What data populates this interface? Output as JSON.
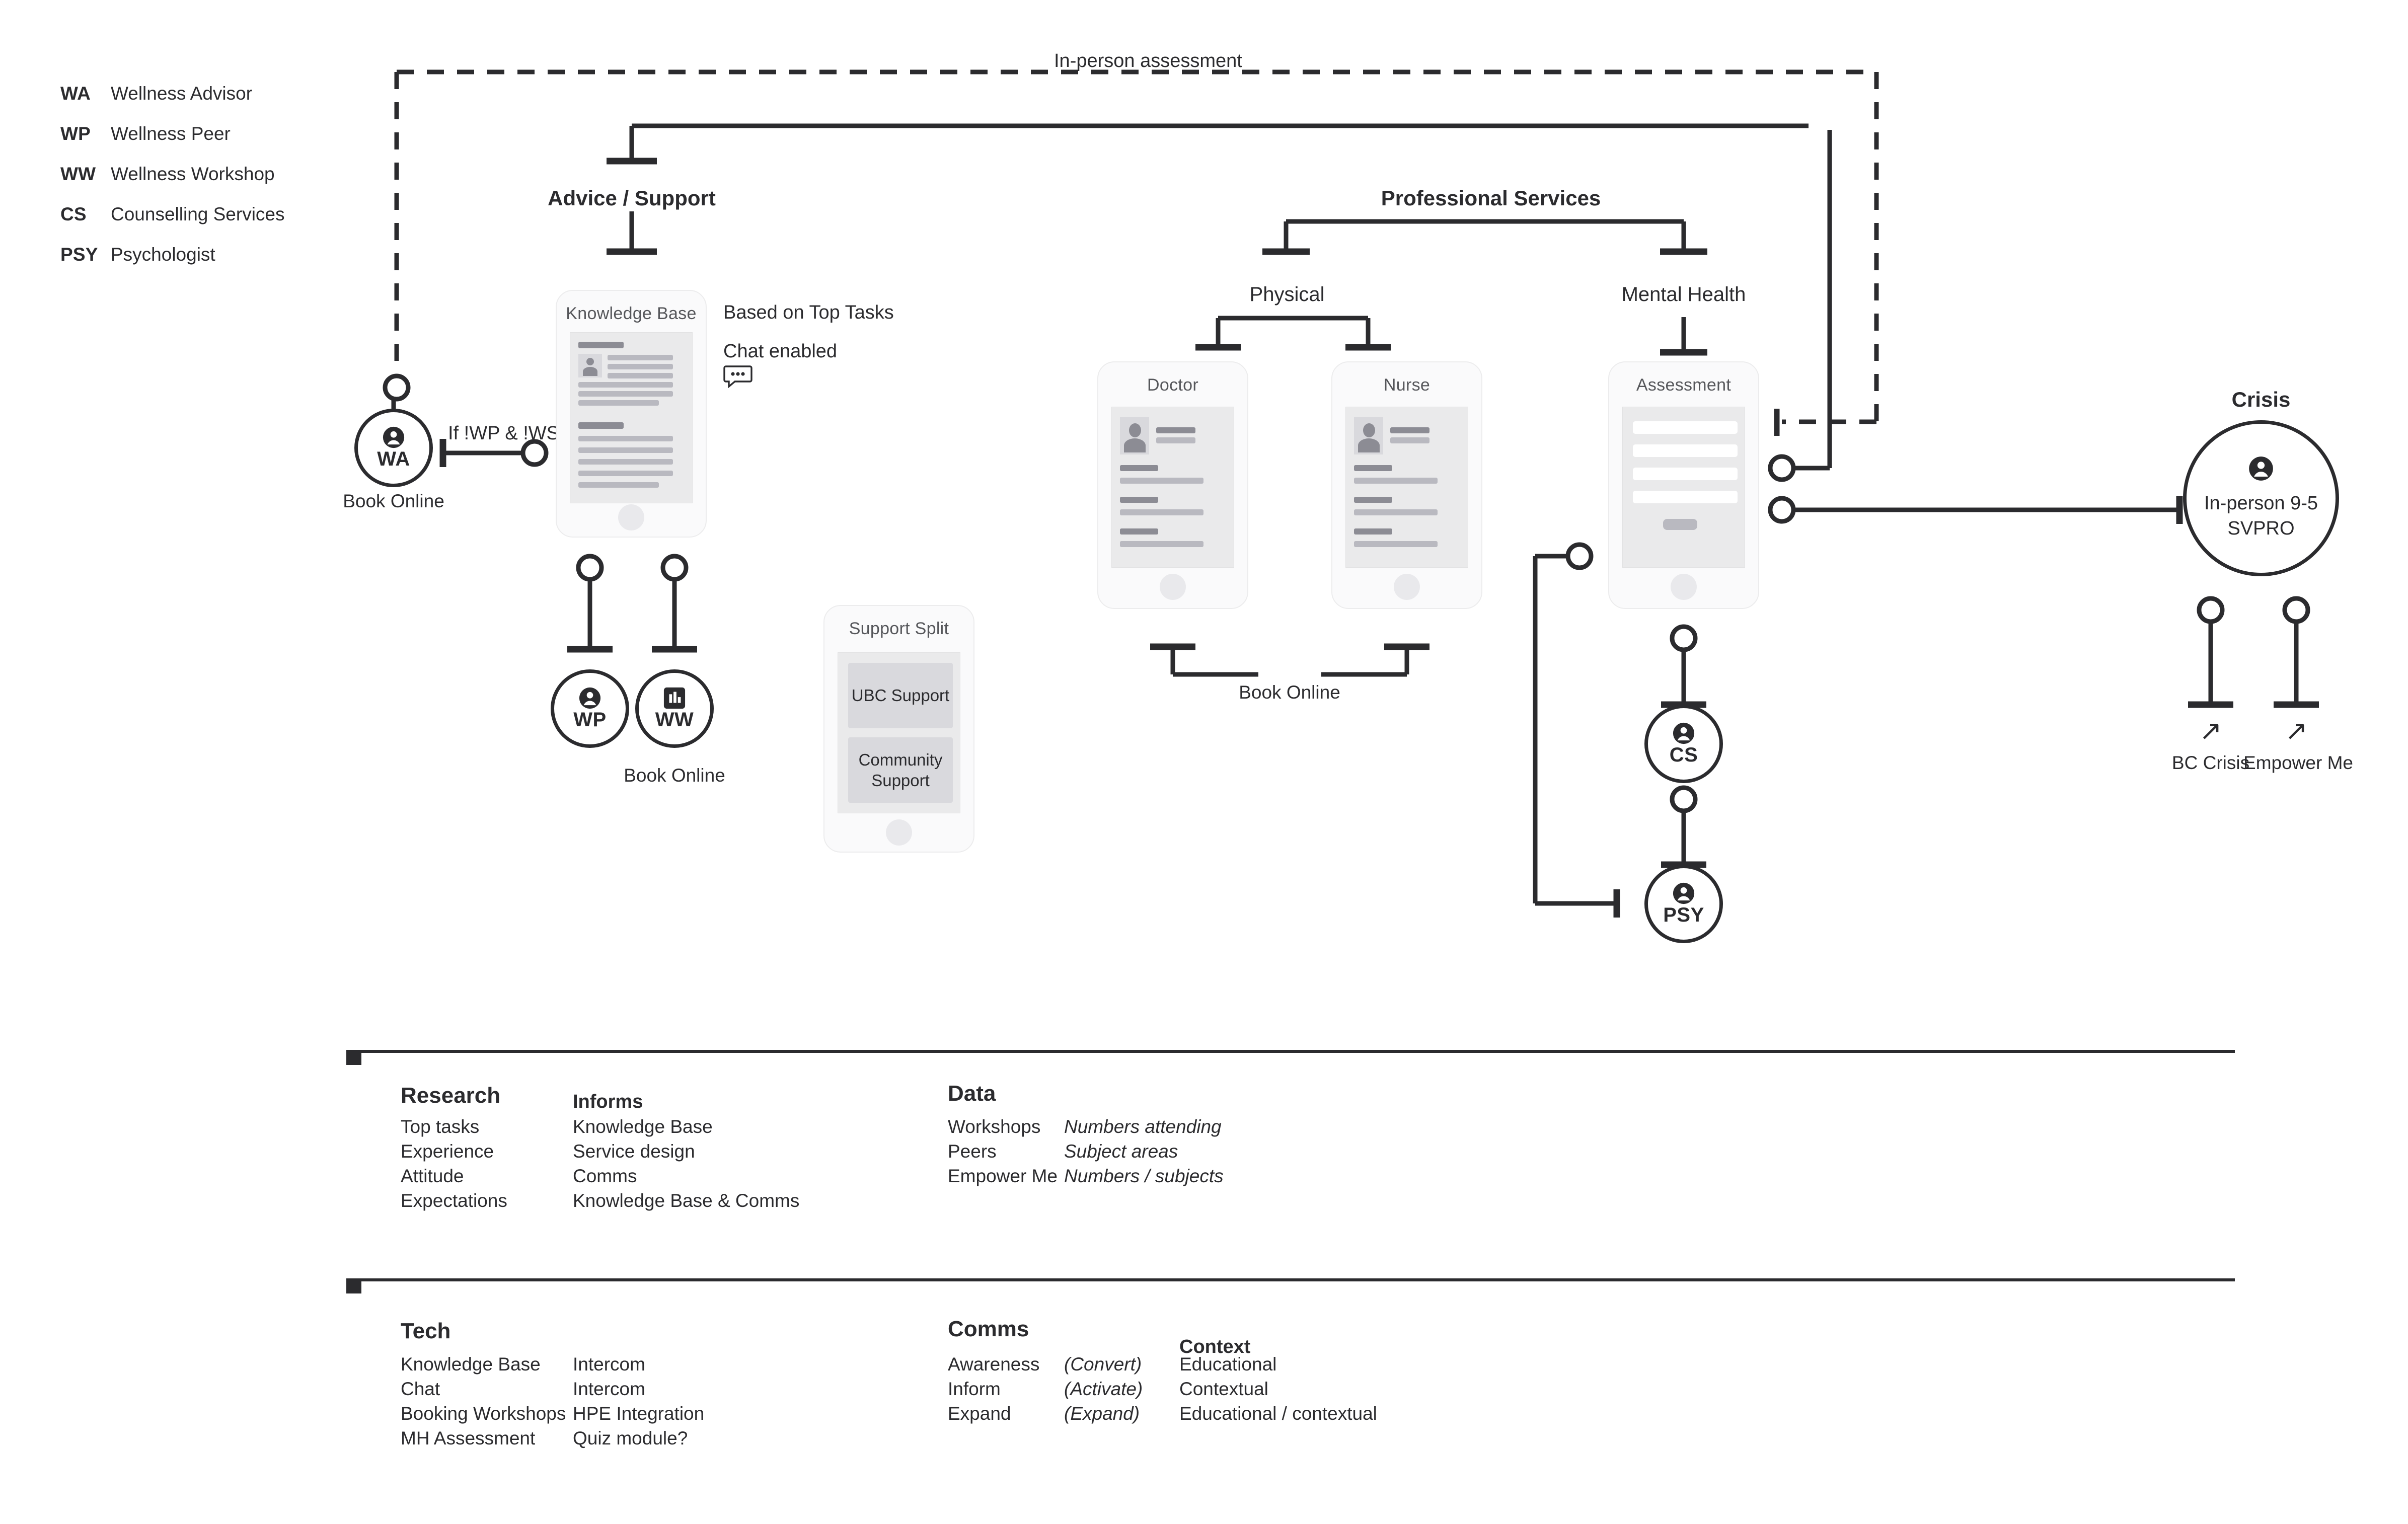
{
  "legend": {
    "items": [
      {
        "abbr": "WA",
        "label": "Wellness Advisor"
      },
      {
        "abbr": "WP",
        "label": "Wellness Peer"
      },
      {
        "abbr": "WW",
        "label": "Wellness Workshop"
      },
      {
        "abbr": "CS",
        "label": "Counselling Services"
      },
      {
        "abbr": "PSY",
        "label": "Psychologist"
      }
    ]
  },
  "diagram": {
    "in_person_assessment": "In-person assessment",
    "advice_support": "Advice / Support",
    "professional_services": "Professional Services",
    "physical": "Physical",
    "mental_health": "Mental Health",
    "crisis": "Crisis",
    "condition_wa": "If !WP & !WS",
    "based_on_top_tasks": "Based on Top Tasks",
    "chat_enabled": "Chat enabled",
    "book_online_wa": "Book Online",
    "book_online_ww": "Book Online",
    "book_online_docnurse": "Book Online",
    "bc_crisis": "BC Crisis",
    "empower_me": "Empower Me",
    "arrow_glyph": "↗"
  },
  "phones": {
    "knowledge_base": {
      "title": "Knowledge Base"
    },
    "support_split": {
      "title": "Support Split",
      "tiles": [
        "UBC Support",
        "Community Support"
      ]
    },
    "doctor": {
      "title": "Doctor"
    },
    "nurse": {
      "title": "Nurse"
    },
    "assessment": {
      "title": "Assessment"
    }
  },
  "nodes": {
    "wa": {
      "label": "WA",
      "icon": "person-icon"
    },
    "wp": {
      "label": "WP",
      "icon": "person-icon"
    },
    "ww": {
      "label": "WW",
      "icon": "bar-chart-icon"
    },
    "cs": {
      "label": "CS",
      "icon": "person-icon"
    },
    "psy": {
      "label": "PSY",
      "icon": "person-icon"
    },
    "crisis": {
      "icon": "person-icon",
      "line1": "In-person 9-5",
      "line2": "SVPRO"
    }
  },
  "panels": {
    "research": {
      "title": "Research",
      "subtitle": "Informs",
      "rows": [
        {
          "left": "Top tasks",
          "right": "Knowledge Base"
        },
        {
          "left": "Experience",
          "right": "Service design"
        },
        {
          "left": "Attitude",
          "right": "Comms"
        },
        {
          "left": "Expectations",
          "right": "Knowledge Base & Comms"
        }
      ]
    },
    "data": {
      "title": "Data",
      "rows": [
        {
          "left": "Workshops",
          "right": "Numbers attending"
        },
        {
          "left": "Peers",
          "right": "Subject areas"
        },
        {
          "left": "Empower Me",
          "right": "Numbers / subjects"
        }
      ]
    },
    "tech": {
      "title": "Tech",
      "rows": [
        {
          "left": "Knowledge Base",
          "right": "Intercom"
        },
        {
          "left": "Chat",
          "right": "Intercom"
        },
        {
          "left": "Booking Workshops",
          "right": "HPE Integration"
        },
        {
          "left": "MH Assessment",
          "right": "Quiz module?"
        }
      ]
    },
    "comms": {
      "title": "Comms",
      "rows": [
        {
          "left": "Awareness",
          "right": "(Convert)"
        },
        {
          "left": "Inform",
          "right": "(Activate)"
        },
        {
          "left": "Expand",
          "right": "(Expand)"
        }
      ]
    },
    "context": {
      "title": "Context",
      "rows": [
        "Educational",
        "Contextual",
        "Educational / contextual"
      ]
    }
  },
  "colors": {
    "ink": "#2b2b2e",
    "phone_bg": "#fafafb",
    "screen": "#eaeaeb",
    "bar": "#b9b9c0"
  }
}
